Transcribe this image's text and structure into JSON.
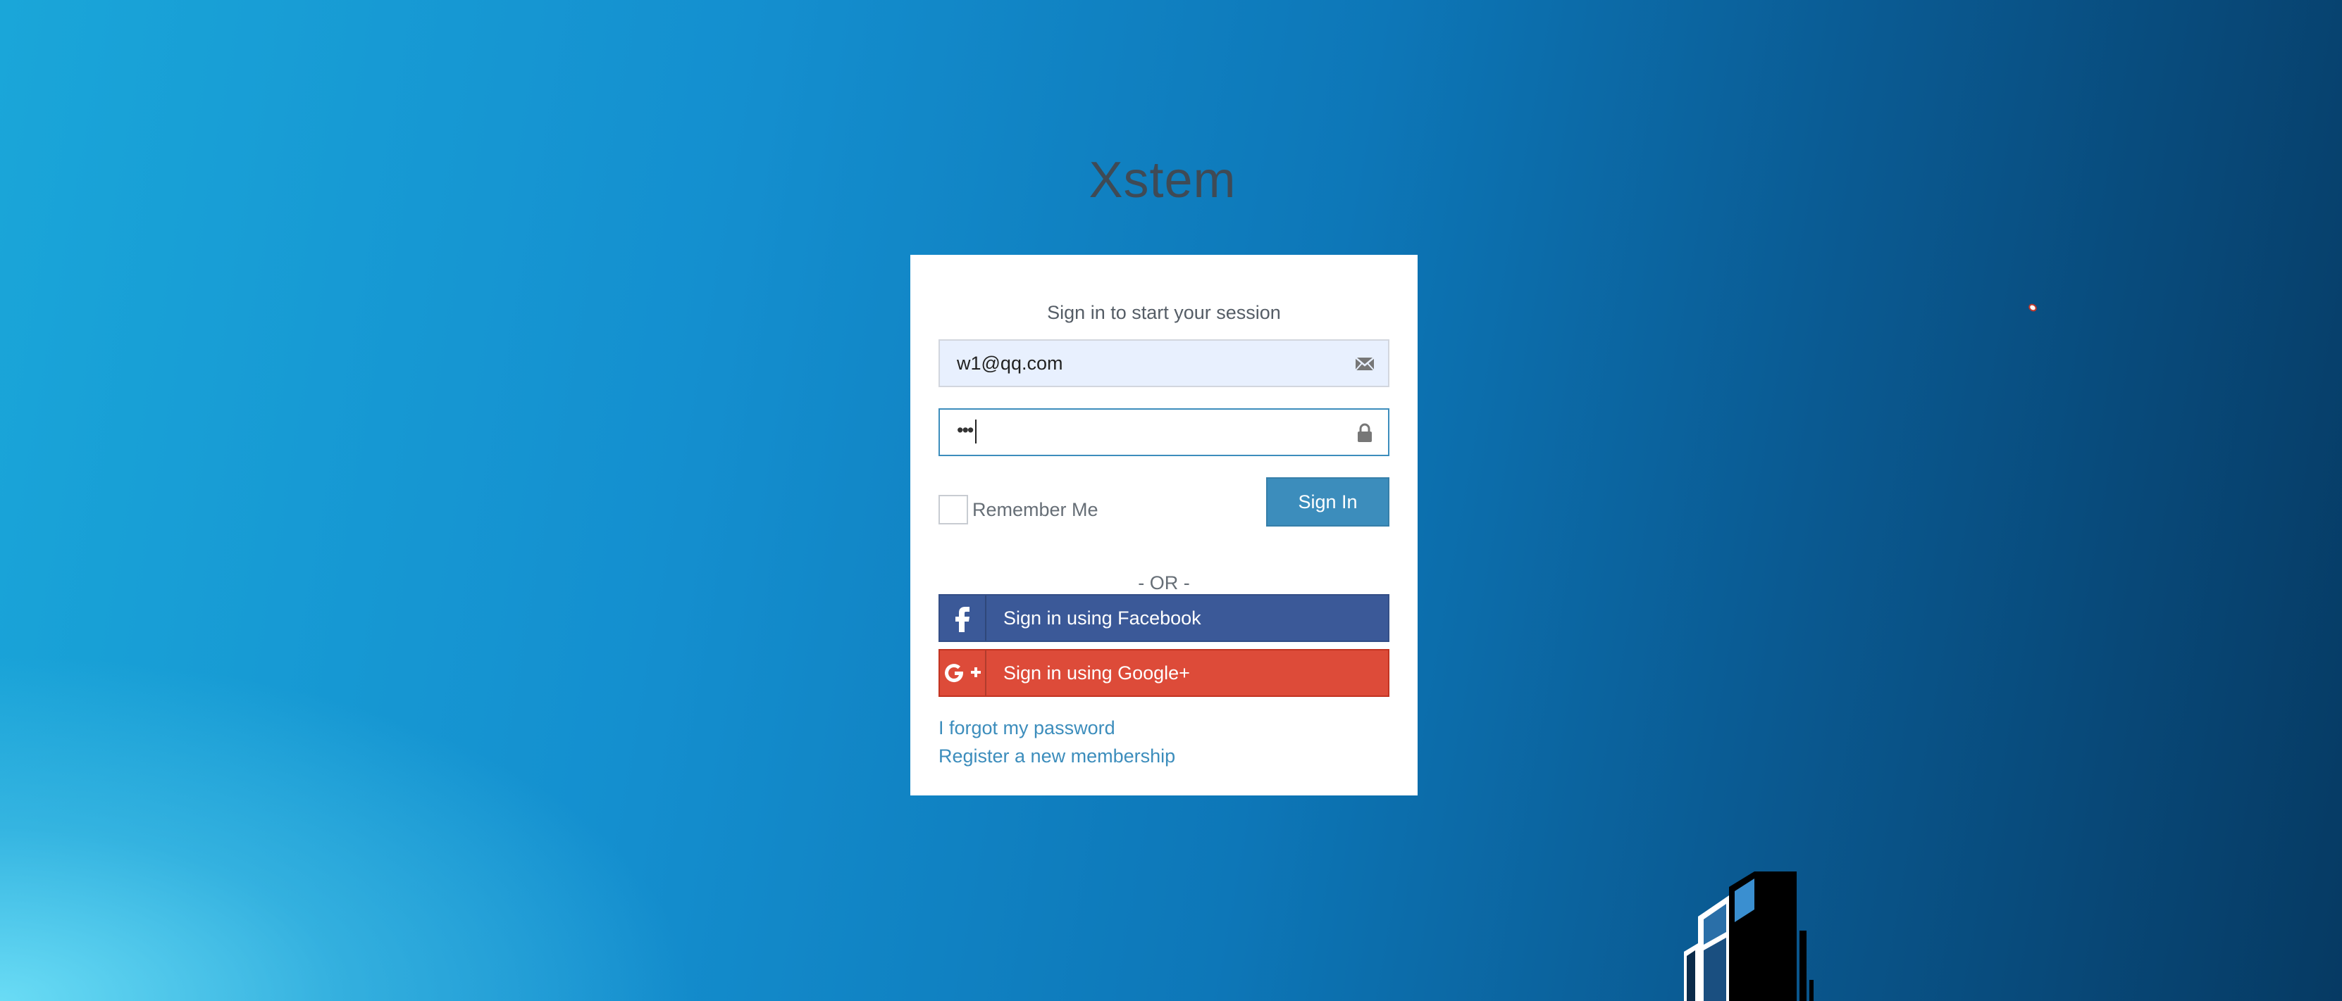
{
  "app": {
    "logo_text": "Xstem"
  },
  "login": {
    "message": "Sign in to start your session",
    "email_value": "w1@qq.com",
    "email_icon": "envelope-icon",
    "password_mask": "•••",
    "password_icon": "lock-icon",
    "remember_label": "Remember Me",
    "remember_checked": false,
    "signin_label": "Sign In",
    "or_text": "- OR -",
    "facebook_label": "Sign in using Facebook",
    "facebook_icon": "facebook-icon",
    "google_label": "Sign in using Google+",
    "google_icon": "google-plus-icon",
    "forgot_link": "I forgot my password",
    "register_link": "Register a new membership"
  },
  "colors": {
    "primary": "#3c8dbc",
    "facebook": "#3b5998",
    "google": "#dd4b39",
    "email_autofill_bg": "#e8f0fe"
  }
}
